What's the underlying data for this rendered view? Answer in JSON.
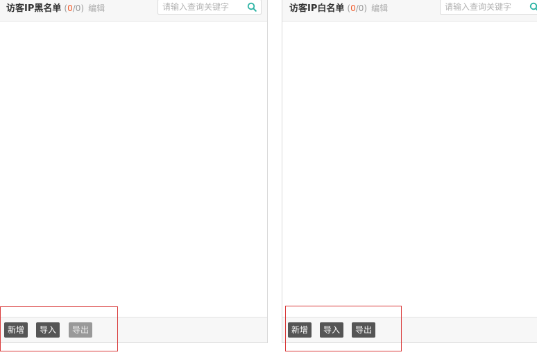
{
  "blacklist": {
    "title": "访客IP黑名单",
    "count_open": "(",
    "count_current": "0",
    "count_sep": "/",
    "count_total": "0",
    "count_close": ")",
    "edit_label": "编辑",
    "search_placeholder": "请输入查询关键字",
    "buttons": {
      "add": "新增",
      "import": "导入",
      "export": "导出"
    },
    "export_disabled": true
  },
  "whitelist": {
    "title": "访客IP白名单",
    "count_open": "(",
    "count_current": "0",
    "count_sep": "/",
    "count_total": "0",
    "count_close": ")",
    "edit_label": "编辑",
    "search_placeholder": "请输入查询关键字",
    "buttons": {
      "add": "新增",
      "import": "导入",
      "export": "导出"
    },
    "export_disabled": false
  },
  "colors": {
    "count_highlight": "#f05a2a",
    "search_icon": "#2bb3a4",
    "button_bg": "#555555",
    "button_disabled_bg": "#999999",
    "annotation": "#d93a3a"
  }
}
